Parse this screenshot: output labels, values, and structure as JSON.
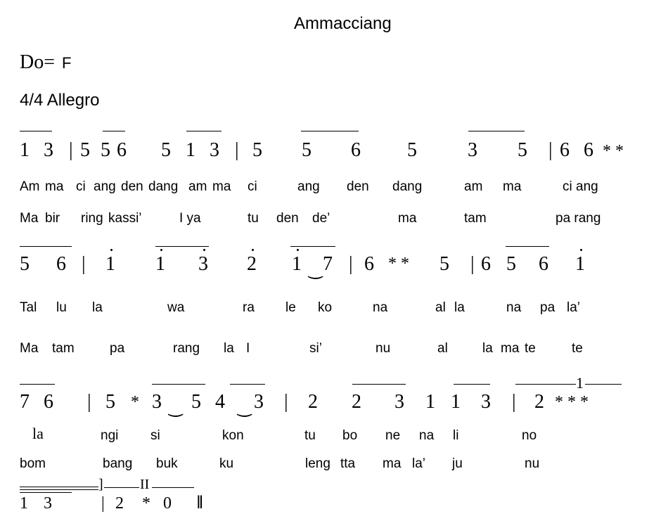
{
  "title": "Ammacciang",
  "key": {
    "do": "Do=",
    "note": "F"
  },
  "tempo": "4/4 Allegro",
  "row1": {
    "notes": [
      "1",
      "3",
      "|",
      "5",
      "5",
      "6",
      "5",
      "1",
      "3",
      "|",
      "5",
      "5",
      "6",
      "5",
      "3",
      "5",
      "|",
      "6",
      "6",
      "* *"
    ],
    "lyrics1": [
      "Am",
      "ma",
      "ci",
      "ang",
      "den",
      "dang",
      "am",
      "ma",
      "ci",
      "ang",
      "den",
      "dang",
      "am",
      "ma",
      "ci ang"
    ],
    "lyrics2": [
      "Ma",
      "bir",
      "ring",
      "kassi’",
      "I ya",
      "tu",
      "den",
      "de’",
      "ma",
      "tam",
      "pa rang"
    ]
  },
  "row2": {
    "notes": [
      "5",
      "6",
      "|",
      "1",
      "1",
      "3",
      "2",
      "1",
      "‿",
      "7",
      "|",
      "6",
      "* *",
      "5",
      "|",
      "6",
      "5",
      "6",
      "1"
    ],
    "lyrics1": [
      "Tal",
      "lu",
      "la",
      "wa",
      "ra",
      "le",
      "ko",
      "na",
      "al",
      "la",
      "na",
      "pa",
      "la’"
    ],
    "lyrics2": [
      "Ma",
      "tam",
      "pa",
      "rang",
      "la",
      "I",
      "si’",
      "nu",
      "al",
      "la",
      "ma",
      "te",
      "te"
    ]
  },
  "row3": {
    "notes": [
      "7",
      "6",
      "|",
      "5",
      "*",
      "3",
      "‿",
      "5",
      "4",
      "‿",
      "3",
      "|",
      "2",
      "2",
      "3",
      "1",
      "1",
      "3",
      "|",
      "2",
      "* * *"
    ],
    "volta": "1",
    "lyrics1": [
      "la",
      "ngi",
      "si",
      "kon",
      "tu",
      "bo",
      "ne",
      "na",
      "li",
      "no"
    ],
    "lyrics2": [
      "bom",
      "bang",
      "buk",
      "ku",
      "leng",
      "tta",
      "ma",
      "la’",
      "ju",
      "nu"
    ]
  },
  "row4": {
    "bracket": "]",
    "volta": "II",
    "notes": [
      "1",
      "3",
      "|",
      "2",
      "*",
      "0",
      "‖"
    ]
  }
}
